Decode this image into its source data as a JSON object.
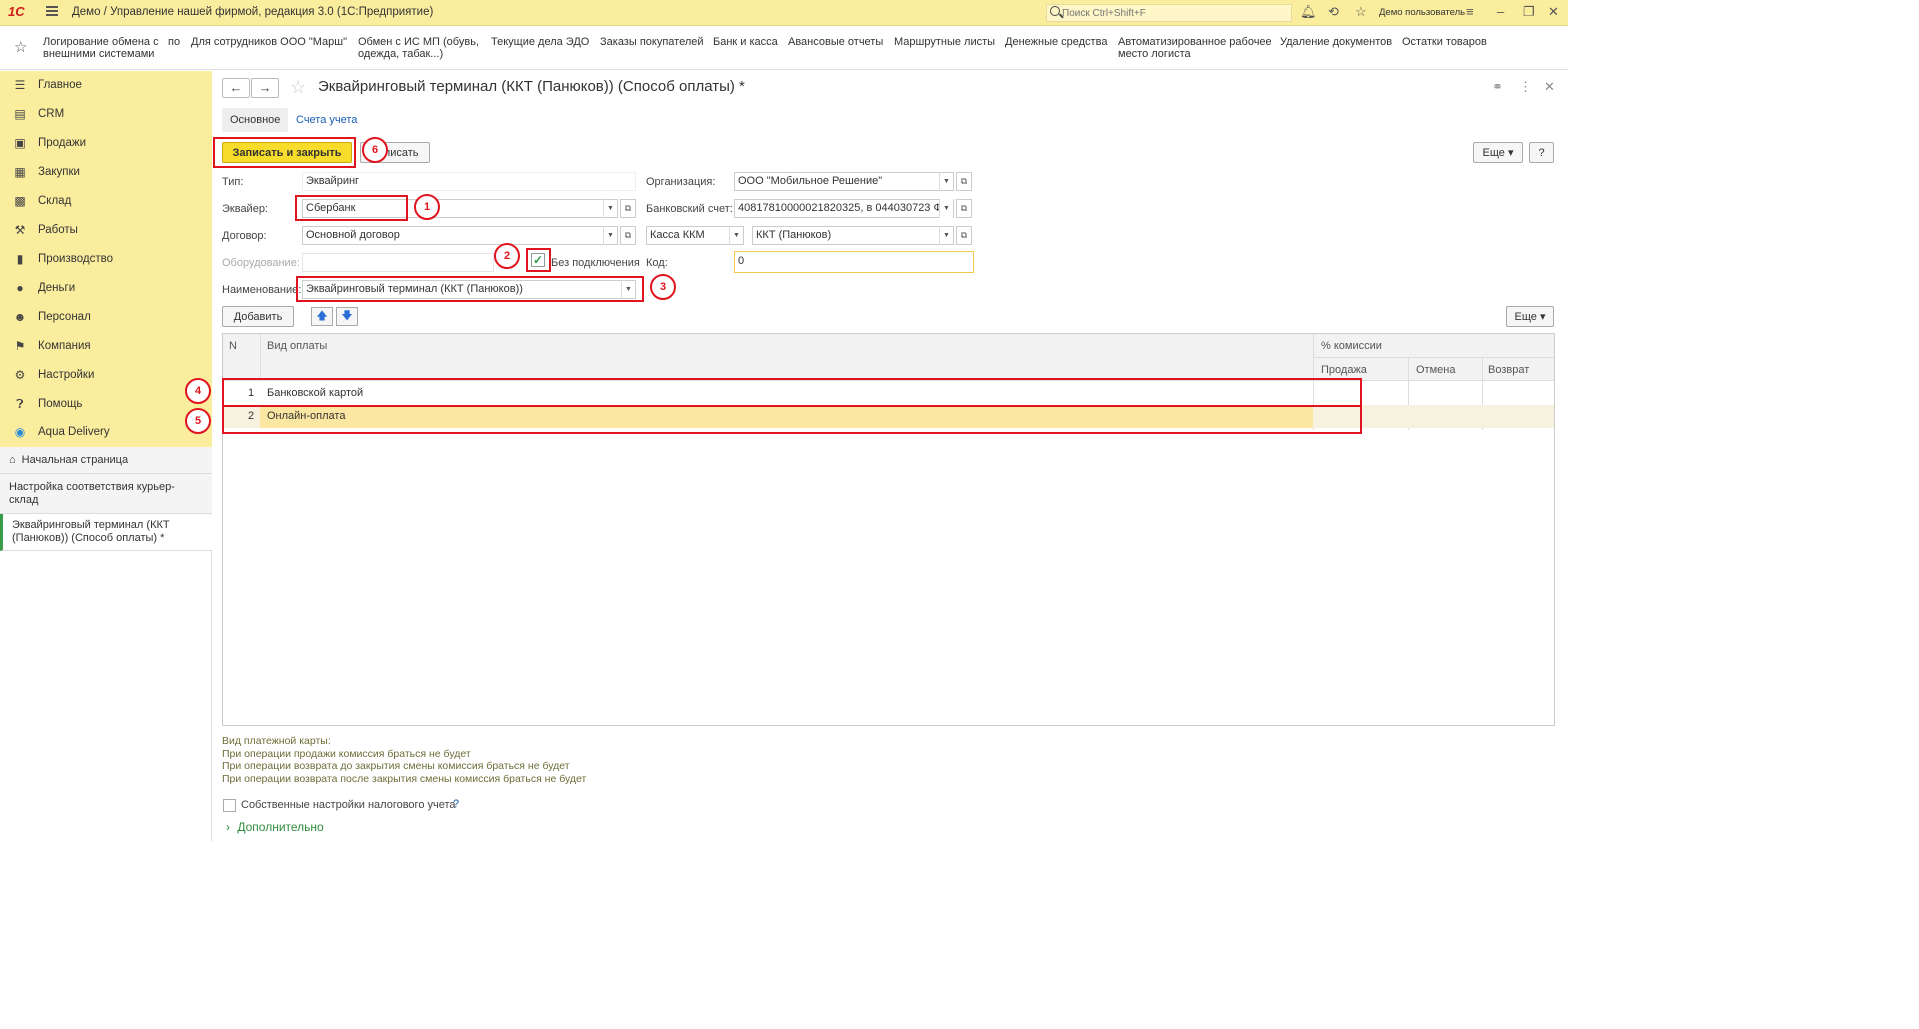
{
  "topbar": {
    "logo": "1С",
    "app_title": "Демо / Управление нашей фирмой, редакция 3.0  (1С:Предприятие)",
    "search_placeholder": "Поиск Ctrl+Shift+F",
    "user": "Демо пользователь"
  },
  "favorites": [
    "Логирование обмена с внешними системами",
    "по",
    "Для сотрудников ООО \"Марш\"",
    "Обмен с ИС МП (обувь, одежда, табак...)",
    "Текущие дела ЭДО",
    "Заказы покупателей",
    "Банк и касса",
    "Авансовые отчеты",
    "Маршрутные листы",
    "Денежные средства",
    "Автоматизированное рабочее место логиста",
    "Удаление документов",
    "Остатки товаров"
  ],
  "sidebar": {
    "items": [
      {
        "label": "Главное",
        "icon": "menu-lines-icon"
      },
      {
        "label": "CRM",
        "icon": "crm-icon"
      },
      {
        "label": "Продажи",
        "icon": "basket-icon"
      },
      {
        "label": "Закупки",
        "icon": "purchases-icon"
      },
      {
        "label": "Склад",
        "icon": "warehouse-icon"
      },
      {
        "label": "Работы",
        "icon": "tools-icon"
      },
      {
        "label": "Производство",
        "icon": "factory-icon"
      },
      {
        "label": "Деньги",
        "icon": "money-icon"
      },
      {
        "label": "Персонал",
        "icon": "people-icon"
      },
      {
        "label": "Компания",
        "icon": "flag-icon"
      },
      {
        "label": "Настройки",
        "icon": "gear-icon"
      },
      {
        "label": "Помощь",
        "icon": "help-icon"
      },
      {
        "label": "Aqua Delivery",
        "icon": "location-pin-icon"
      }
    ],
    "open_windows": [
      "Начальная страница",
      "Настройка соответствия курьер-склад",
      "Эквайринговый терминал  (ККТ (Панюков)) (Способ оплаты) *"
    ]
  },
  "form": {
    "title": "Эквайринговый терминал  (ККТ (Панюков)) (Способ оплаты) *",
    "tabs": [
      "Основное",
      "Счета учета"
    ],
    "save_close_label": "Записать и закрыть",
    "save_label": "Записать",
    "more_label": "Еще",
    "help_label": "?",
    "fields": {
      "type_label": "Тип:",
      "type_value": "Эквайринг",
      "acquirer_label": "Эквайер:",
      "acquirer_value": "Сбербанк",
      "contract_label": "Договор:",
      "contract_value": "Основной договор",
      "equipment_label": "Оборудование:",
      "equipment_value": "",
      "no_connection_label": "Без подключения",
      "name_label": "Наименование:",
      "name_value": "Эквайринговый терминал  (ККТ (Панюков))",
      "organization_label": "Организация:",
      "organization_value": "ООО \"Мобильное Решение\"",
      "bank_account_label": "Банковский счет:",
      "bank_account_value": "40817810000021820325, в 044030723 Ф",
      "cash_register_type": "Касса ККМ",
      "cash_register_value": "ККТ (Панюков)",
      "code_label": "Код:",
      "code_value": "0"
    },
    "add_label": "Добавить",
    "table": {
      "headers": {
        "n": "N",
        "payment_type": "Вид оплаты",
        "commission": "% комиссии",
        "sale": "Продажа",
        "cancel": "Отмена",
        "refund": "Возврат"
      },
      "rows": [
        {
          "n": "1",
          "payment_type": "Банковской картой"
        },
        {
          "n": "2",
          "payment_type": "Онлайн-оплата"
        }
      ]
    },
    "info_lines": [
      "Вид платежной карты:",
      "При операции продажи комиссия браться не будет",
      "При операции возврата до закрытия смены комиссия браться не будет",
      "При операции возврата после закрытия смены комиссия браться не будет"
    ],
    "own_tax_settings_label": "Собственные настройки налогового учета",
    "own_tax_help": "?",
    "additional_label": "Дополнительно"
  },
  "annotations": [
    "1",
    "2",
    "3",
    "4",
    "5",
    "6"
  ],
  "colors": {
    "accent_yellow": "#fbed9e",
    "primary_button": "#f8dc2b",
    "annotation_red": "#e0141e",
    "selected_row": "#fbe7a1",
    "link_blue": "#1a5fb4"
  }
}
